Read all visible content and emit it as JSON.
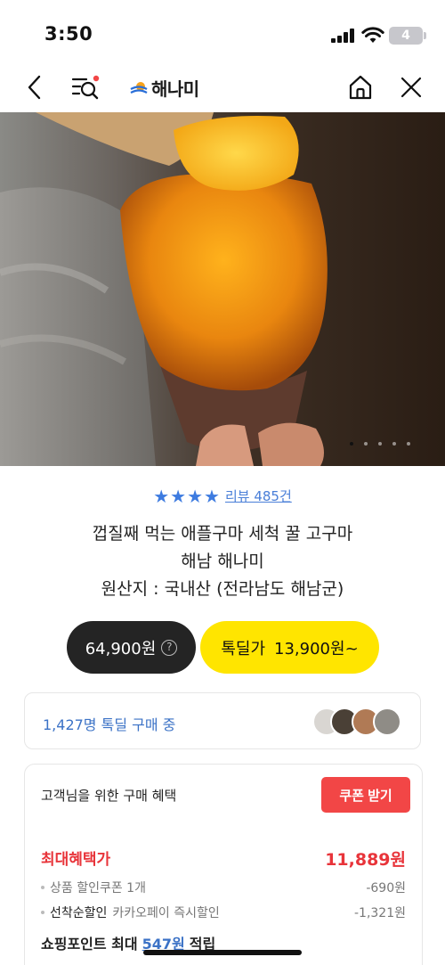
{
  "status": {
    "time": "3:50",
    "battery": "4"
  },
  "nav": {
    "brand": "해나미",
    "icons": [
      "back-chevron-icon",
      "search-list-icon",
      "home-icon",
      "close-icon"
    ]
  },
  "hero": {
    "slide_count": 5,
    "active_slide": 1
  },
  "rating": {
    "stars": 4,
    "review_text": "리뷰 485건"
  },
  "product": {
    "title_line1": "껍질째 먹는 애플구마 세척 꿀 고구마",
    "title_line2": "해남 해나미",
    "title_line3": "원산지 : 국내산 (전라남도 해남군)"
  },
  "price": {
    "regular": "64,900원",
    "deal_label": "톡딜가",
    "deal_price": "13,900원~"
  },
  "buying": {
    "text": "1,427명 톡딜 구매 중"
  },
  "benefits": {
    "title": "고객님을 위한 구매 혜택",
    "coupon_button": "쿠폰 받기",
    "max_label": "최대혜택가",
    "max_value": "11,889원",
    "coupon_label": "상품 할인쿠폰 1개",
    "coupon_value": "-690원",
    "instant_strong": "선착순할인",
    "instant_label": "카카오페이 즉시할인",
    "instant_value": "-1,321원",
    "points_prefix": "쇼핑포인트 최대",
    "points_value": "547원",
    "points_suffix": "적립"
  },
  "colors": {
    "accent_blue": "#3b72c6",
    "deal_yellow": "#ffe500",
    "coupon_red": "#f24646",
    "dark_pill": "#242424"
  }
}
